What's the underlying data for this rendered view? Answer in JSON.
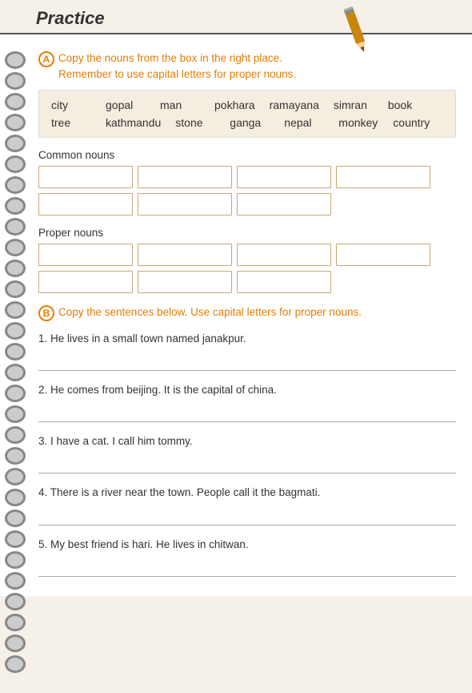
{
  "page": {
    "title": "Practice"
  },
  "pencil": {
    "label": "pencil-icon"
  },
  "sectionA": {
    "circle": "A",
    "instruction_line1": "Copy the nouns from the box in the right place.",
    "instruction_line2": "Remember to use capital letters for proper nouns.",
    "words_row1": [
      "city",
      "gopal",
      "man",
      "pokhara",
      "ramayana",
      "simran",
      "book"
    ],
    "words_row2": [
      "tree",
      "kathmandu",
      "stone",
      "ganga",
      "nepal",
      "monkey",
      "country"
    ],
    "common_nouns_label": "Common nouns",
    "proper_nouns_label": "Proper nouns"
  },
  "sectionB": {
    "circle": "B",
    "instruction": "Copy the sentences below. Use capital letters for proper nouns.",
    "sentences": [
      "1. He lives in a small town named janakpur.",
      "2. He comes from beijing. It is the capital of china.",
      "3. I have a cat. I call him tommy.",
      "4. There is a river near the town. People call it the bagmati.",
      "5. My best friend is hari. He lives in chitwan."
    ]
  }
}
